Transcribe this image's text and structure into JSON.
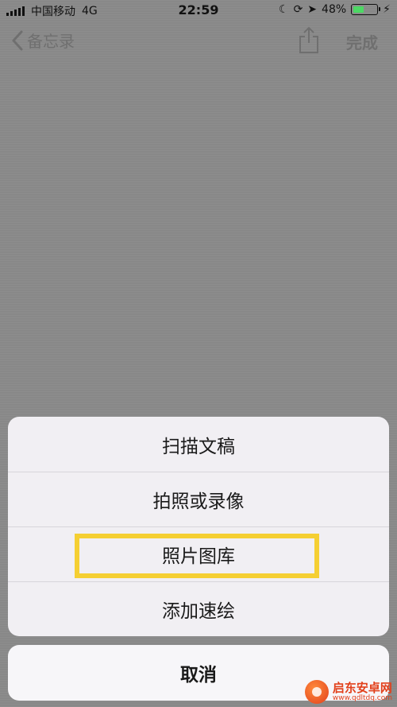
{
  "status_bar": {
    "carrier": "中国移动",
    "network": "4G",
    "time": "22:59",
    "battery_percent": "48%",
    "battery_level": 0.48,
    "battery_color": "#4cd964"
  },
  "nav": {
    "back_label": "备忘录",
    "done_label": "完成"
  },
  "action_sheet": {
    "items": [
      {
        "label": "扫描文稿"
      },
      {
        "label": "拍照或录像"
      },
      {
        "label": "照片图库"
      },
      {
        "label": "添加速绘"
      }
    ],
    "highlighted_index": 2,
    "highlight_color": "#f5cf32",
    "cancel_label": "取消"
  },
  "watermark": {
    "title": "启东安卓网",
    "url": "www.qdltdq.com"
  }
}
